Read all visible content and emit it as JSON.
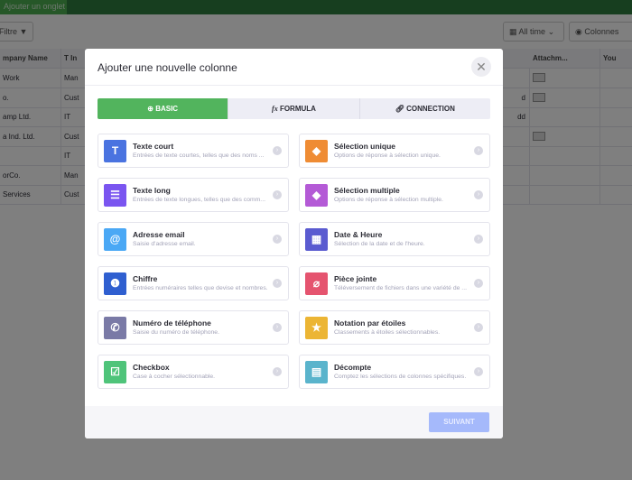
{
  "topbar": {
    "add_tab": "Ajouter un onglet"
  },
  "toolbar": {
    "filter": "Filtre",
    "date_range": "All time",
    "columns": "Colonnes"
  },
  "table": {
    "headers": [
      "mpany Name",
      "T In",
      "Attachm...",
      "You"
    ],
    "rows": [
      {
        "company": "Work",
        "industry": "Man",
        "tag": "",
        "attachment": true
      },
      {
        "company": "o.",
        "industry": "Cust",
        "tag": "d",
        "attachment": true
      },
      {
        "company": "amp Ltd.",
        "industry": "IT",
        "tag": "dd",
        "attachment": false
      },
      {
        "company": "a Ind. Ltd.",
        "industry": "Cust",
        "tag": "",
        "attachment": true
      },
      {
        "company": "",
        "industry": "IT",
        "tag": "",
        "attachment": false
      },
      {
        "company": "orCo.",
        "industry": "Man",
        "tag": "",
        "attachment": false
      },
      {
        "company": "Services",
        "industry": "Cust",
        "tag": "",
        "attachment": false
      }
    ]
  },
  "modal": {
    "title": "Ajouter une nouvelle colonne",
    "close_icon": "close-icon",
    "tabs": [
      {
        "label": "BASIC",
        "icon": "plus-circle-icon",
        "active": true
      },
      {
        "label": "FORMULA",
        "icon": "fx-icon",
        "active": false
      },
      {
        "label": "CONNECTION",
        "icon": "link-icon",
        "active": false
      }
    ],
    "fields": [
      {
        "title": "Texte court",
        "desc": "Entrées de texte courtes, telles que des noms ...",
        "icon": "text-icon",
        "color": "#4a73e0"
      },
      {
        "title": "Sélection unique",
        "desc": "Options de réponse à sélection unique.",
        "icon": "tag-icon",
        "color": "#ef8c34"
      },
      {
        "title": "Texte long",
        "desc": "Entrées de texte longues, telles que des comm...",
        "icon": "paragraph-icon",
        "color": "#7a55f0"
      },
      {
        "title": "Sélection multiple",
        "desc": "Options de réponse à sélection multiple.",
        "icon": "tags-icon",
        "color": "#b45ad6"
      },
      {
        "title": "Adresse email",
        "desc": "Saisie d'adresse email.",
        "icon": "at-icon",
        "color": "#4aa8f5"
      },
      {
        "title": "Date & Heure",
        "desc": "Sélection de la date et de l'heure.",
        "icon": "calendar-icon",
        "color": "#5a5bd0"
      },
      {
        "title": "Chiffre",
        "desc": "Entrées numéraires telles que devise et nombres.",
        "icon": "number-icon",
        "color": "#2f5fd0"
      },
      {
        "title": "Pièce jointe",
        "desc": "Téléversement de fichiers dans une variété de ...",
        "icon": "paperclip-icon",
        "color": "#e5546f"
      },
      {
        "title": "Numéro de téléphone",
        "desc": "Saisie du numéro de téléphone.",
        "icon": "phone-icon",
        "color": "#7a7aa6"
      },
      {
        "title": "Notation par étoiles",
        "desc": "Classements à étoiles sélectionnables.",
        "icon": "star-icon",
        "color": "#ecb534"
      },
      {
        "title": "Checkbox",
        "desc": "Case à cocher sélectionnable.",
        "icon": "checkbox-icon",
        "color": "#4fc47a"
      },
      {
        "title": "Décompte",
        "desc": "Comptez les sélections de colonnes spécifiques.",
        "icon": "calculator-icon",
        "color": "#5ab4cc"
      }
    ],
    "next_button": "SUIVANT"
  }
}
